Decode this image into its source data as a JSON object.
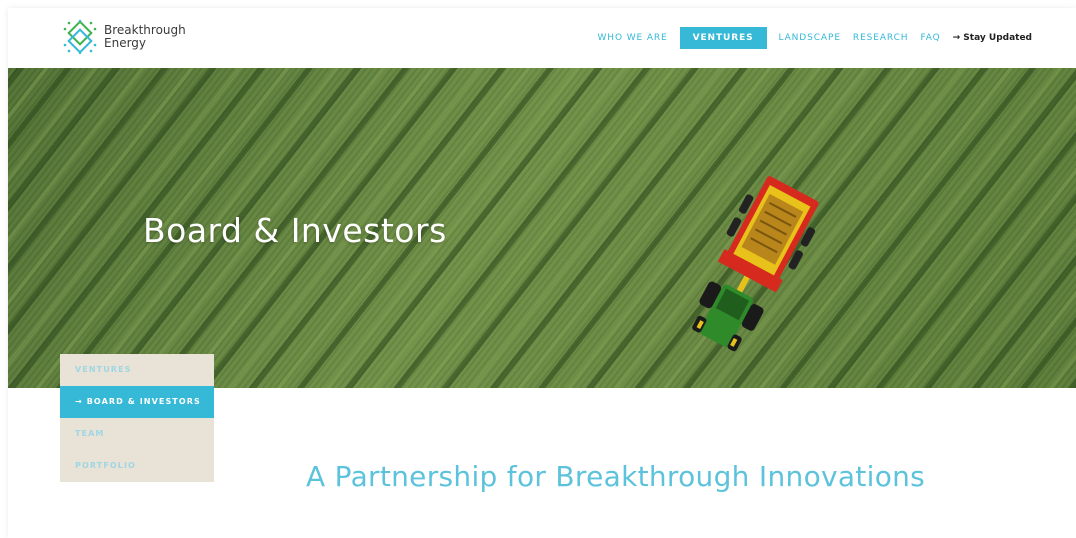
{
  "brand": {
    "name_line1": "Breakthrough",
    "name_line2": "Energy"
  },
  "nav": {
    "items": [
      {
        "label": "WHO WE ARE",
        "active": false
      },
      {
        "label": "VENTURES",
        "active": true
      },
      {
        "label": "LANDSCAPE",
        "active": false
      },
      {
        "label": "RESEARCH",
        "active": false
      },
      {
        "label": "FAQ",
        "active": false
      }
    ],
    "cta": "→ Stay Updated"
  },
  "hero": {
    "title": "Board & Investors"
  },
  "subnav": {
    "items": [
      {
        "label": "VENTURES",
        "active": false
      },
      {
        "label": "→ BOARD & INVESTORS",
        "active": true
      },
      {
        "label": "TEAM",
        "active": false
      },
      {
        "label": "PORTFOLIO",
        "active": false
      }
    ]
  },
  "main": {
    "tagline": "A Partnership for Breakthrough Innovations"
  },
  "colors": {
    "accent": "#35b9d6",
    "tagline": "#5dc3dc",
    "subnav_bg": "#e9e2d6"
  }
}
